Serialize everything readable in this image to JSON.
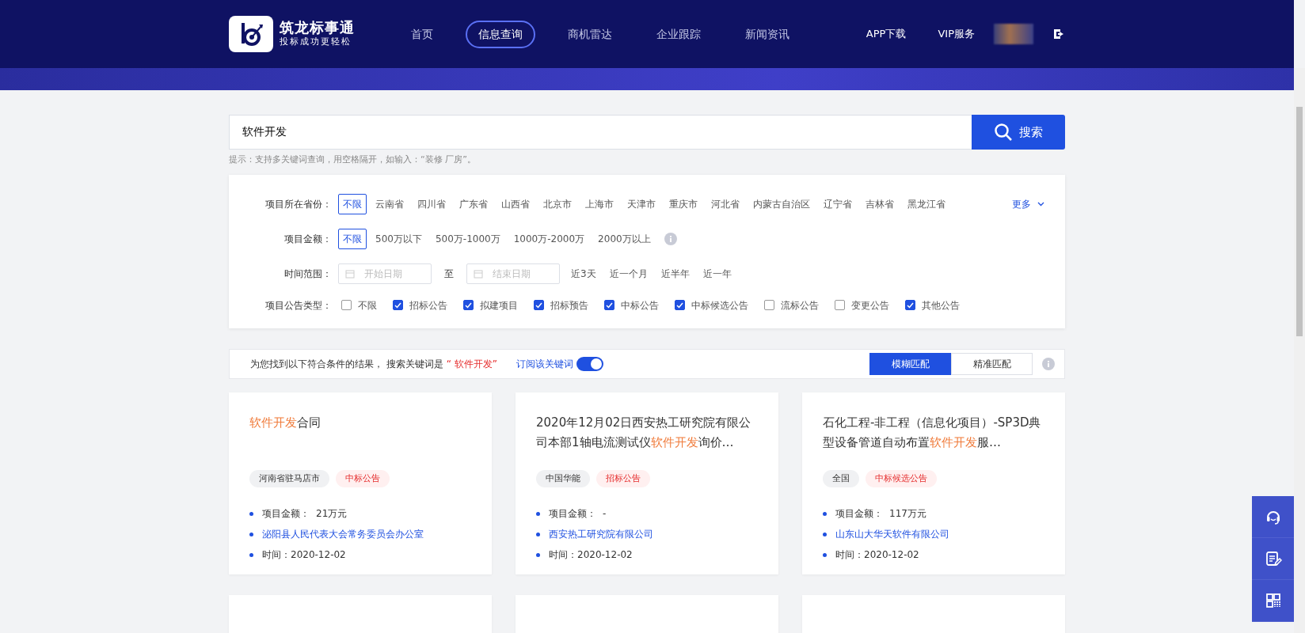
{
  "header": {
    "logo": {
      "name": "筑龙标事通",
      "slogan": "投标成功更轻松"
    },
    "nav": [
      {
        "label": "首页",
        "selected": false
      },
      {
        "label": "信息查询",
        "selected": true
      },
      {
        "label": "商机雷达",
        "selected": false
      },
      {
        "label": "企业跟踪",
        "selected": false
      },
      {
        "label": "新闻资讯",
        "selected": false
      }
    ],
    "links": [
      "APP下载",
      "VIP服务"
    ]
  },
  "search": {
    "value": "软件开发",
    "button": "搜索",
    "hint": "提示：支持多关键词查询，用空格隔开，如输入：“装修 厂房”。"
  },
  "filters": {
    "province": {
      "label": "项目所在省份：",
      "more": "更多",
      "options": [
        {
          "label": "不限",
          "selected": true
        },
        {
          "label": "云南省",
          "selected": false
        },
        {
          "label": "四川省",
          "selected": false
        },
        {
          "label": "广东省",
          "selected": false
        },
        {
          "label": "山西省",
          "selected": false
        },
        {
          "label": "北京市",
          "selected": false
        },
        {
          "label": "上海市",
          "selected": false
        },
        {
          "label": "天津市",
          "selected": false
        },
        {
          "label": "重庆市",
          "selected": false
        },
        {
          "label": "河北省",
          "selected": false
        },
        {
          "label": "内蒙古自治区",
          "selected": false
        },
        {
          "label": "辽宁省",
          "selected": false
        },
        {
          "label": "吉林省",
          "selected": false
        },
        {
          "label": "黑龙江省",
          "selected": false
        }
      ]
    },
    "amount": {
      "label": "项目金额：",
      "options": [
        {
          "label": "不限",
          "selected": true
        },
        {
          "label": "500万以下",
          "selected": false
        },
        {
          "label": "500万-1000万",
          "selected": false
        },
        {
          "label": "1000万-2000万",
          "selected": false
        },
        {
          "label": "2000万以上",
          "selected": false
        }
      ]
    },
    "time": {
      "label": "时间范围：",
      "start_placeholder": "开始日期",
      "separator": "至",
      "end_placeholder": "结束日期",
      "quick": [
        "近3天",
        "近一个月",
        "近半年",
        "近一年"
      ]
    },
    "types": {
      "label": "项目公告类型：",
      "options": [
        {
          "label": "不限",
          "checked": false
        },
        {
          "label": "招标公告",
          "checked": true
        },
        {
          "label": "拟建项目",
          "checked": true
        },
        {
          "label": "招标预告",
          "checked": true
        },
        {
          "label": "中标公告",
          "checked": true
        },
        {
          "label": "中标候选公告",
          "checked": true
        },
        {
          "label": "流标公告",
          "checked": false
        },
        {
          "label": "变更公告",
          "checked": false
        },
        {
          "label": "其他公告",
          "checked": true
        }
      ]
    }
  },
  "result_bar": {
    "text": "为您找到以下符合条件的结果， 搜索关键词是",
    "keyword": "“ 软件开发”",
    "subscribe": {
      "label": "订阅该关键词",
      "on": true
    },
    "match": [
      {
        "label": "模糊匹配",
        "selected": true
      },
      {
        "label": "精准匹配",
        "selected": false
      }
    ]
  },
  "cards": [
    {
      "title": [
        {
          "text": "软件开发",
          "highlight": true
        },
        {
          "text": "合同",
          "highlight": false
        }
      ],
      "region": "河南省驻马店市",
      "type": "中标公告",
      "amount_label": "项目金额：",
      "amount": "21万元",
      "org": "泌阳县人民代表大会常务委员会办公室",
      "time": "时间：2020-12-02"
    },
    {
      "title": [
        {
          "text": "2020年12月02日西安热工研究院有限公司本部1轴电流测试仪",
          "highlight": false
        },
        {
          "text": "软件开发",
          "highlight": true
        },
        {
          "text": "询价…",
          "highlight": false
        }
      ],
      "region": "中国华能",
      "type": "招标公告",
      "amount_label": "项目金额：",
      "amount": "-",
      "org": "西安热工研究院有限公司",
      "time": "时间：2020-12-02"
    },
    {
      "title": [
        {
          "text": "石化工程-非工程（信息化项目）-SP3D典型设备管道自动布置",
          "highlight": false
        },
        {
          "text": "软件开发",
          "highlight": true
        },
        {
          "text": "服…",
          "highlight": false
        }
      ],
      "region": "全国",
      "type": "中标候选公告",
      "amount_label": "项目金额：",
      "amount": "117万元",
      "org": "山东山大华天软件有限公司",
      "time": "时间：2020-12-02"
    }
  ]
}
